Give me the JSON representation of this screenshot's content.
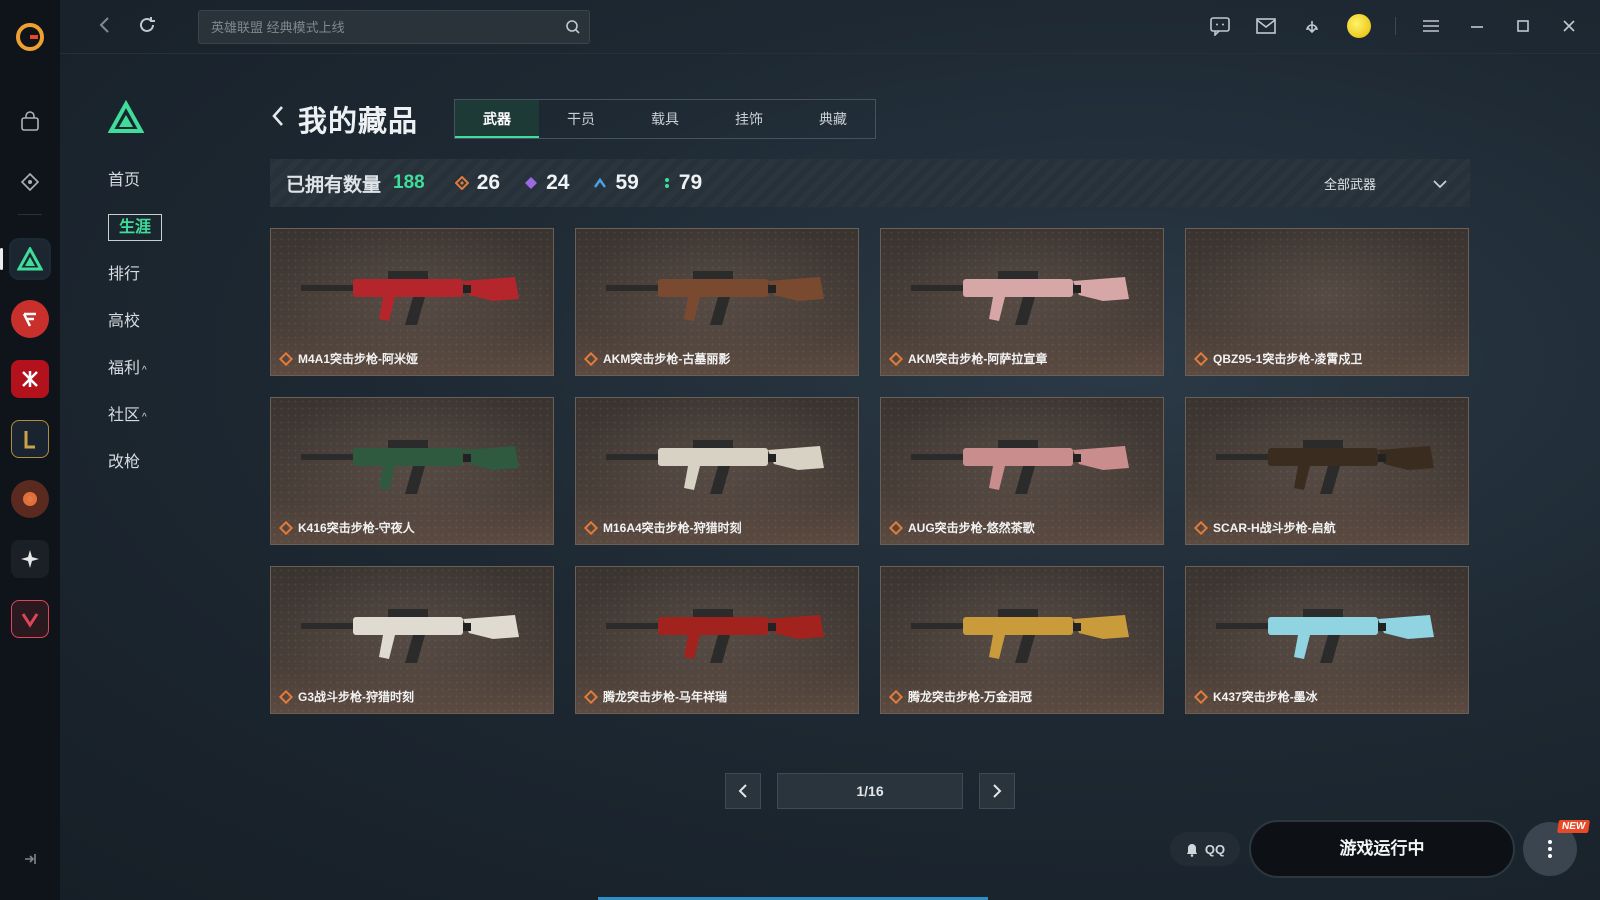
{
  "search": {
    "placeholder": "英雄联盟 经典模式上线"
  },
  "sidenav": {
    "items": [
      {
        "label": "首页"
      },
      {
        "label": "生涯"
      },
      {
        "label": "排行"
      },
      {
        "label": "高校"
      },
      {
        "label": "福利"
      },
      {
        "label": "社区"
      },
      {
        "label": "改枪"
      }
    ]
  },
  "header": {
    "title": "我的藏品"
  },
  "tabs": [
    {
      "label": "武器"
    },
    {
      "label": "干员"
    },
    {
      "label": "载具"
    },
    {
      "label": "挂饰"
    },
    {
      "label": "典藏"
    }
  ],
  "stats": {
    "owned_label": "已拥有数量",
    "owned_total": "188",
    "tiers": [
      {
        "icon": "orange-diamond-icon",
        "value": "26",
        "color": "#e07b3a"
      },
      {
        "icon": "purple-diamond-icon",
        "value": "24",
        "color": "#9b6ae0"
      },
      {
        "icon": "blue-chevron-icon",
        "value": "59",
        "color": "#4aa3e8"
      },
      {
        "icon": "green-dots-icon",
        "value": "79",
        "color": "#3fdc9a"
      }
    ],
    "filter_label": "全部武器"
  },
  "items": [
    {
      "name": "M4A1突击步枪-阿米娅",
      "color": "#b5252c"
    },
    {
      "name": "AKM突击步枪-古墓丽影",
      "color": "#7a4a30"
    },
    {
      "name": "AKM突击步枪-阿萨拉宣章",
      "color": "#d7a6a6"
    },
    {
      "name": "QBZ95-1突击步枪-凌霄戍卫",
      "color": ""
    },
    {
      "name": "K416突击步枪-守夜人",
      "color": "#2f5a3f"
    },
    {
      "name": "M16A4突击步枪-狩猎时刻",
      "color": "#d8d2c4"
    },
    {
      "name": "AUG突击步枪-悠然茶歌",
      "color": "#c98d8d"
    },
    {
      "name": "SCAR-H战斗步枪-启航",
      "color": "#3a2c1f"
    },
    {
      "name": "G3战斗步枪-狩猎时刻",
      "color": "#e0dbd0"
    },
    {
      "name": "腾龙突击步枪-马年祥瑞",
      "color": "#a2231e"
    },
    {
      "name": "腾龙突击步枪-万金泪冠",
      "color": "#c99b3b"
    },
    {
      "name": "K437突击步枪-墨冰",
      "color": "#8fd4e0"
    }
  ],
  "pagination": {
    "info": "1/16"
  },
  "bottom": {
    "qq_label": "QQ",
    "running_label": "游戏运行中",
    "new_badge": "NEW"
  }
}
